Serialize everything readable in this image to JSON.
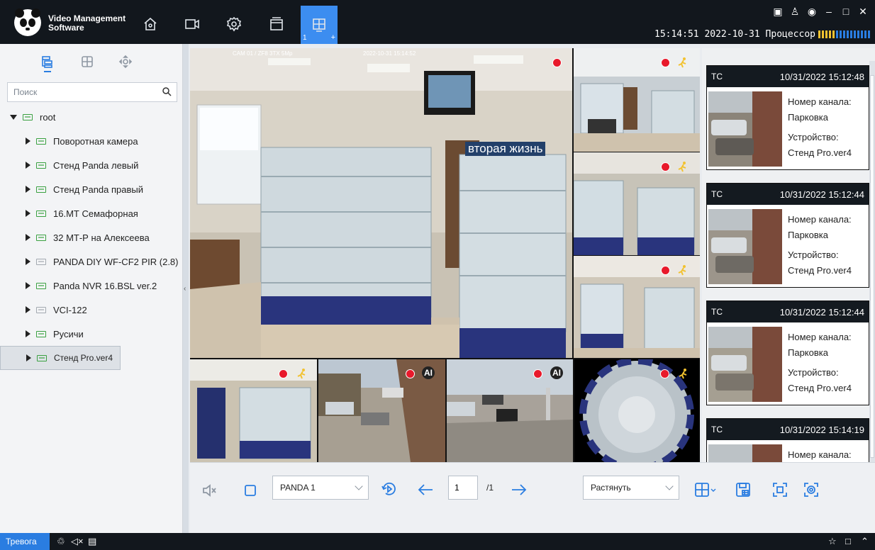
{
  "header": {
    "app_name": "Video Management Software",
    "nav": [
      {
        "name": "home-icon"
      },
      {
        "name": "camera-icon"
      },
      {
        "name": "settings-icon"
      },
      {
        "name": "playback-icon"
      },
      {
        "name": "live-view-icon",
        "active": true,
        "sub_left": "1",
        "sub_right": "+"
      }
    ],
    "clock": "15:14:51 2022-10-31",
    "cpu_label": "Процессор",
    "window_controls": {
      "screen": "▣",
      "user": "♙",
      "msg": "◉",
      "minimize": "–",
      "maximize": "□",
      "close": "✕"
    }
  },
  "left_panel": {
    "search_placeholder": "Поиск",
    "root_label": "root",
    "devices": [
      {
        "label": "Поворотная камера",
        "online": true
      },
      {
        "label": "Стенд Panda левый",
        "online": true
      },
      {
        "label": "Стенд Panda правый",
        "online": true
      },
      {
        "label": "16.МТ Семафорная",
        "online": true
      },
      {
        "label": "32 МТ-Р на Алексеева",
        "online": true
      },
      {
        "label": "PANDA DIY WF-CF2 PIR (2.8)",
        "online": false
      },
      {
        "label": "Panda NVR 16.BSL ver.2",
        "online": true
      },
      {
        "label": "VCI-122",
        "online": false
      },
      {
        "label": "Русичи",
        "online": true
      },
      {
        "label": "Стенд Pro.ver4",
        "online": true,
        "selected": true
      }
    ]
  },
  "video": {
    "main_osd_left": "CAM 01 / ZF8 3TX 5Mp",
    "main_osd_right": "2022-10-31 15:14:52",
    "main_sign": "вторая жизнь",
    "ai_badge": "AI"
  },
  "events": [
    {
      "type": "TC",
      "time": "10/31/2022 15:12:48",
      "channel_label": "Номер канала:",
      "channel": "Парковка",
      "device_label": "Устройство:",
      "device": "Стенд Pro.ver4"
    },
    {
      "type": "TC",
      "time": "10/31/2022 15:12:44",
      "channel_label": "Номер канала:",
      "channel": "Парковка",
      "device_label": "Устройство:",
      "device": "Стенд Pro.ver4"
    },
    {
      "type": "TC",
      "time": "10/31/2022 15:12:44",
      "channel_label": "Номер канала:",
      "channel": "Парковка",
      "device_label": "Устройство:",
      "device": "Стенд Pro.ver4"
    },
    {
      "type": "TC",
      "time": "10/31/2022 15:14:19",
      "channel_label": "Номер канала:",
      "channel": "",
      "device_label": "",
      "device": ""
    }
  ],
  "controls": {
    "layout_name": "PANDA 1",
    "page_current": "1",
    "page_total": "/1",
    "display_mode": "Растянуть"
  },
  "status_bar": {
    "alarm_label": "Тревога"
  },
  "colors": {
    "accent": "#2a7de1",
    "rec": "#e8192b",
    "dark": "#12171d"
  }
}
